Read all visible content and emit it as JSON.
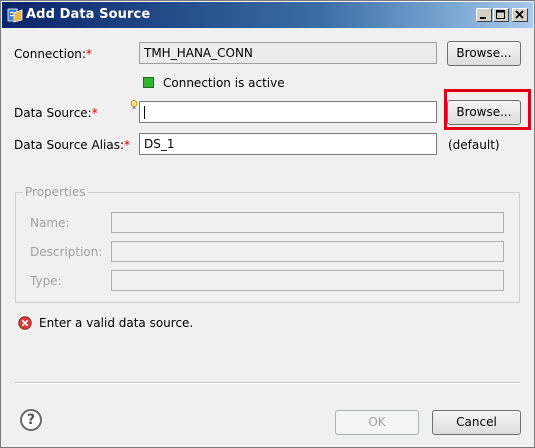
{
  "window": {
    "title": "Add Data Source",
    "icon": "data-source-app-icon",
    "controls": [
      "minimize-icon",
      "maximize-icon",
      "close-icon"
    ]
  },
  "form": {
    "connection": {
      "label": "Connection:",
      "required_mark": "*",
      "value": "TMH_HANA_CONN",
      "browse_label": "Browse..."
    },
    "connection_status": {
      "text": "Connection is active",
      "color": "#2fb52f"
    },
    "data_source": {
      "label": "Data Source:",
      "required_mark": "*",
      "value": "",
      "browse_label": "Browse..."
    },
    "alias": {
      "label": "Data Source Alias:",
      "required_mark": "*",
      "value": "DS_1",
      "default_label": "(default)"
    }
  },
  "properties": {
    "legend": "Properties",
    "name_label": "Name:",
    "description_label": "Description:",
    "type_label": "Type:"
  },
  "message": {
    "icon": "error-icon",
    "text": "Enter a valid data source."
  },
  "footer": {
    "ok_label": "OK",
    "cancel_label": "Cancel",
    "help_icon": "?"
  },
  "colors": {
    "required": "#d40000",
    "highlight": "#e0001b",
    "status_active": "#2fb52f"
  }
}
